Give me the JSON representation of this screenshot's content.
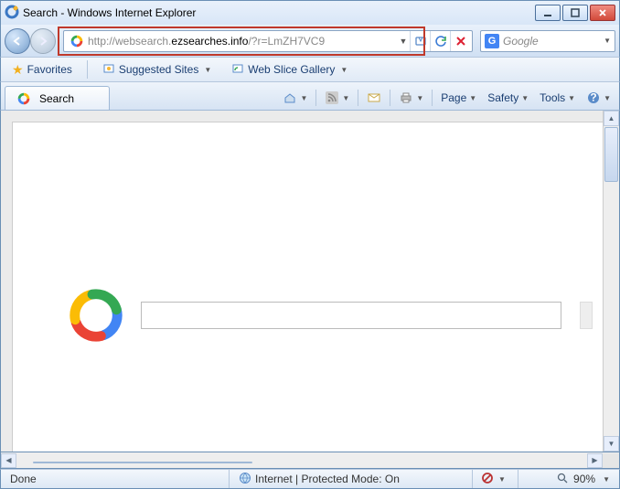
{
  "window": {
    "title": "Search - Windows Internet Explorer",
    "min": "_",
    "max": "❐",
    "close": "✕"
  },
  "nav": {
    "url_prefix": "http://websearch.",
    "url_bold": "ezsearches.info",
    "url_suffix": "/?r=LmZH7VC9",
    "search_placeholder": "Google",
    "compat_alt": "Compatibility",
    "refresh_alt": "Refresh",
    "stop_alt": "Stop"
  },
  "favbar": {
    "favorites": "Favorites",
    "suggested": "Suggested Sites",
    "webslice": "Web Slice Gallery"
  },
  "tab": {
    "title": "Search"
  },
  "cmdbar": {
    "page": "Page",
    "safety": "Safety",
    "tools": "Tools",
    "home": "Home",
    "feeds": "Feeds",
    "mail": "Mail",
    "print": "Print",
    "help": "Help"
  },
  "content": {
    "search_value": ""
  },
  "status": {
    "done": "Done",
    "zone": "Internet | Protected Mode: On",
    "zoom": "90%"
  }
}
